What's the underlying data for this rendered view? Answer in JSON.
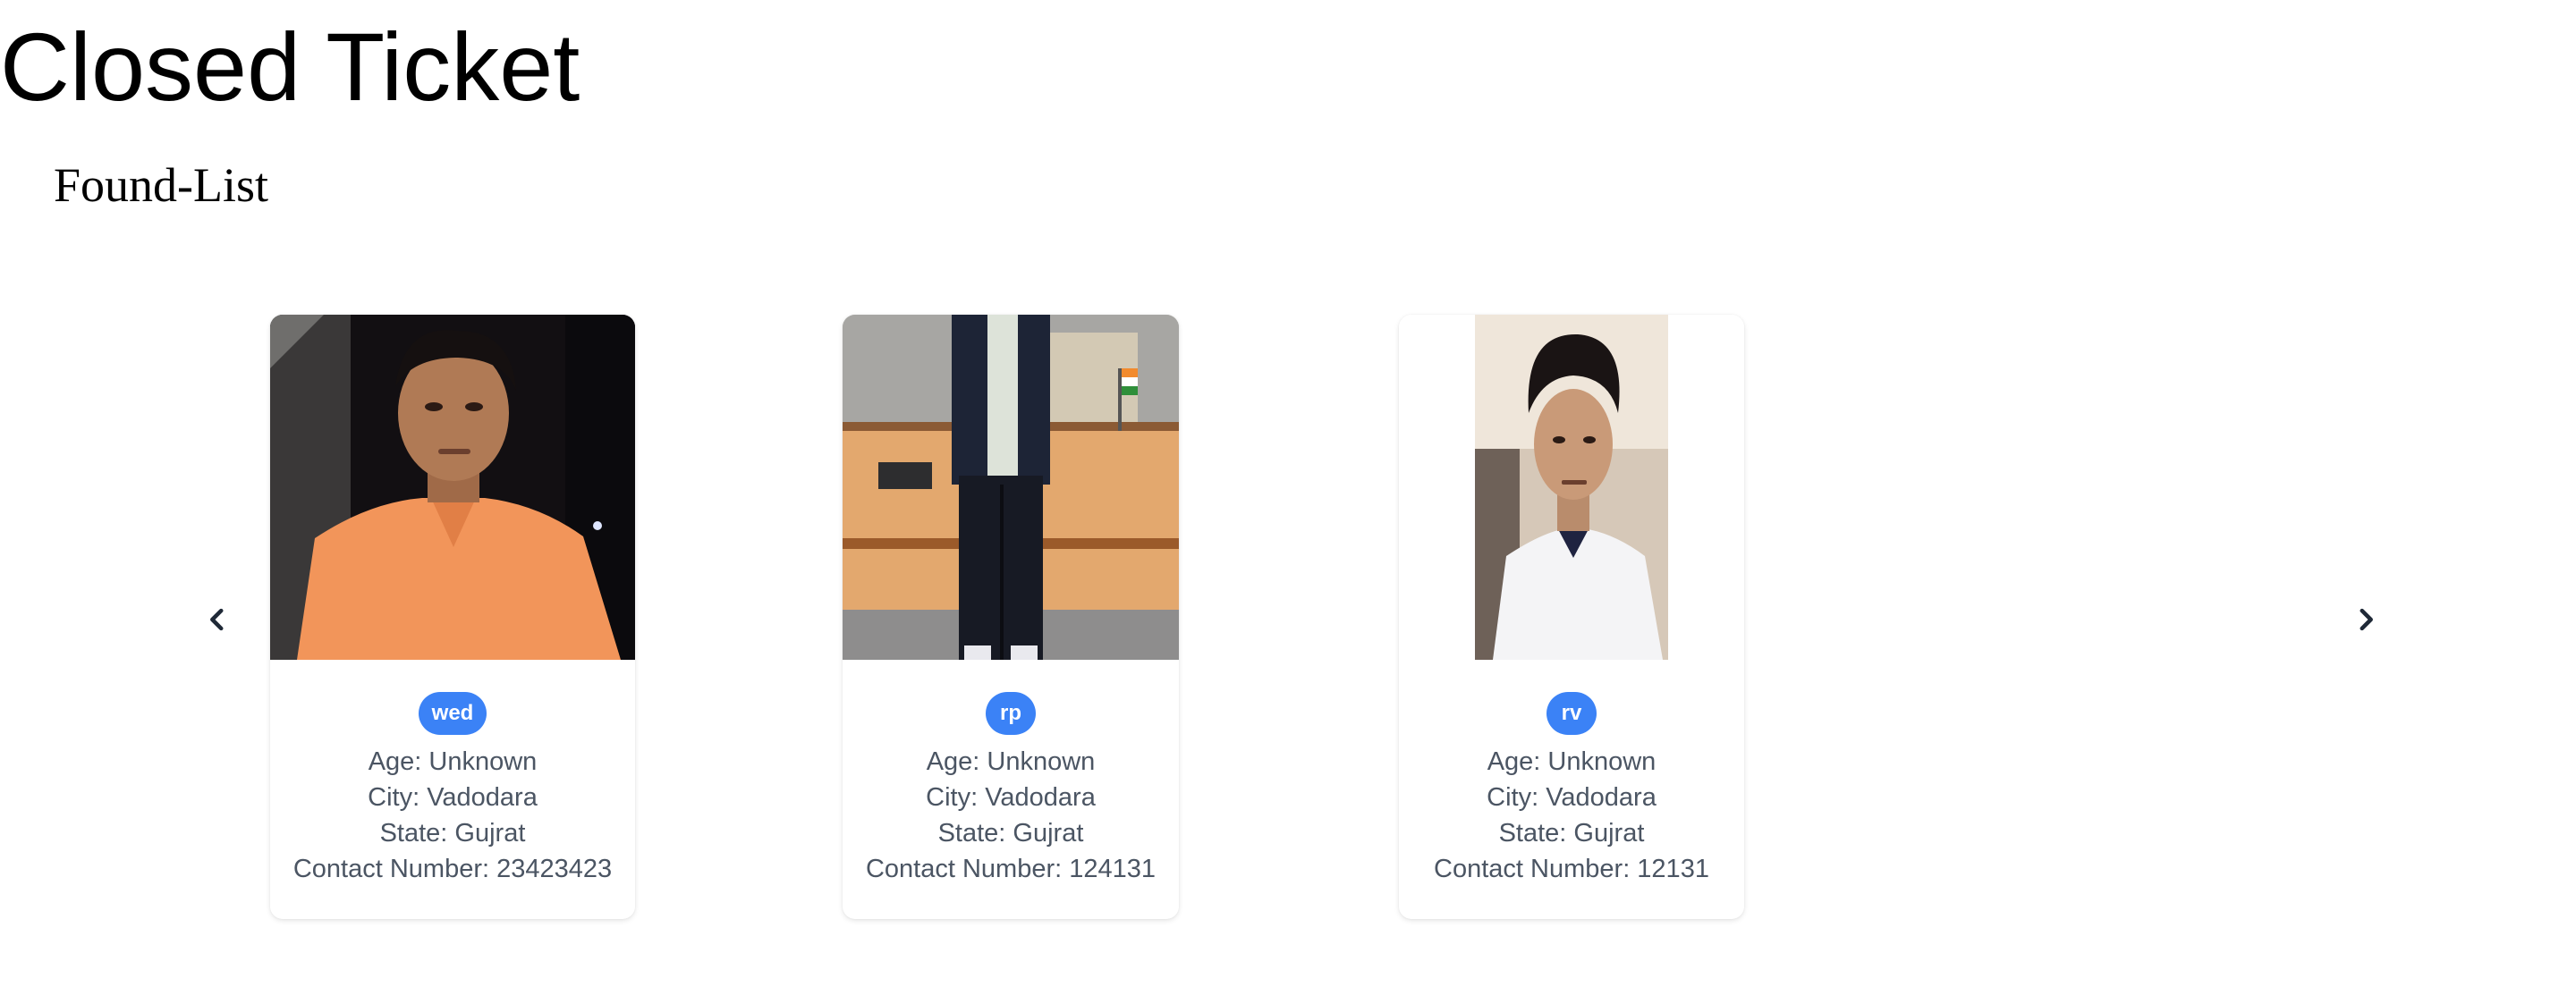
{
  "page": {
    "title": "Closed Ticket",
    "section_title": "Found-List"
  },
  "colors": {
    "badge": "#3b82f6",
    "info_text": "#4b5563",
    "arrow": "#1f2937"
  },
  "carousel": {
    "prev_icon": "chevron-left-icon",
    "next_icon": "chevron-right-icon",
    "cards": [
      {
        "name": "wed",
        "age": "Age: Unknown",
        "city": "City: Vadodara",
        "state": "State: Gujrat",
        "contact": "Contact Number: 23423423"
      },
      {
        "name": "rp",
        "age": "Age: Unknown",
        "city": "City: Vadodara",
        "state": "State: Gujrat",
        "contact": "Contact Number: 124131"
      },
      {
        "name": "rv",
        "age": "Age: Unknown",
        "city": "City: Vadodara",
        "state": "State: Gujrat",
        "contact": "Contact Number: 12131"
      }
    ]
  }
}
